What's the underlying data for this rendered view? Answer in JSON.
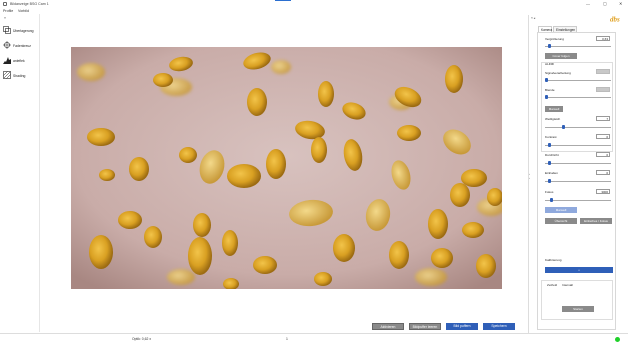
{
  "window": {
    "title": "Bildanzeige BSG Cam 1",
    "controls": [
      "—",
      "▢",
      "✕"
    ]
  },
  "menu": [
    "Profile",
    "Vorbild"
  ],
  "left_panel": {
    "collapse": "«",
    "items": [
      {
        "label": "Überlagerung",
        "icon": "overlay-icon"
      },
      {
        "label": "Fadenkreuz",
        "icon": "crosshair-icon"
      },
      {
        "label": "anleflek",
        "icon": "histogram-icon"
      },
      {
        "label": "Shading",
        "icon": "shading-icon"
      }
    ]
  },
  "bottom_buttons": [
    "Aktivieren",
    "Bildpuffer leeren",
    "Bild puffern",
    "Speichern"
  ],
  "status": {
    "left": "Optik: 0,62 x",
    "center": "1"
  },
  "right_panel": {
    "top": "« ◂",
    "tabs": [
      "Kamera",
      "Einstellungen"
    ],
    "logo": "dbs",
    "vergroesserung": {
      "label": "Vergrößerung",
      "value": "0,63",
      "level": 0.05
    },
    "cover_button": "Cover folgen",
    "group_label": "ALFMI",
    "signal": {
      "label": "Signalverarbeitung",
      "level": 0.0
    },
    "blende": {
      "label": "Blende",
      "level": 0.0
    },
    "manuell1": "Manuell",
    "weissgleich": {
      "label": "Weißgleich",
      "value": "7",
      "level": 0.27
    },
    "kontrast": {
      "label": "Kontrast",
      "value": "0",
      "level": 0.05
    },
    "durchlicht": {
      "label": "Durchlicht",
      "value": "0",
      "level": 0.05
    },
    "einhalten": {
      "label": "Einhalten",
      "value": "0",
      "level": 0.05
    },
    "fokus": {
      "label": "Fokus",
      "value": "3000",
      "level": 0.08
    },
    "manuell2": "Manuell",
    "ubersicht": "Übersicht",
    "einfach": "Einfaches / Fokus",
    "kalibrierung": "Kalibrierung",
    "kal_button": "⌂",
    "mode_tabs": [
      "Zeitfeld",
      "Intervall"
    ],
    "start_button": "Starten"
  },
  "colors": {
    "accent": "#2f5fb8",
    "led": "#1fd02a"
  }
}
